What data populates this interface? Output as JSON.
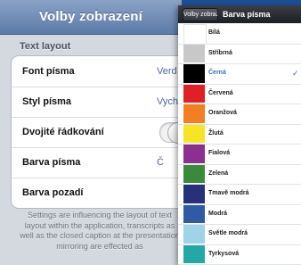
{
  "left": {
    "title": "Volby zobrazení",
    "section_header": "Text layout",
    "rows": [
      {
        "label": "Font písma",
        "value": "Verd"
      },
      {
        "label": "Styl písma",
        "value": "Vych"
      },
      {
        "label": "Dvojité řádkování",
        "toggle": false
      },
      {
        "label": "Barva písma",
        "value": "Č"
      },
      {
        "label": "Barva pozadí",
        "value": ""
      }
    ],
    "footer": "Settings are influencing the layout of text layout within the application, transcripts as well as the closed caption at the presentation mirroring are effected as"
  },
  "right": {
    "back_label": "Volby zobrazení",
    "title": "Barva písma",
    "selected_index": 2,
    "colors": [
      {
        "label": "Bílá",
        "color": "#ffffff"
      },
      {
        "label": "Stříbrná",
        "color": "#c8c8c8"
      },
      {
        "label": "Černá",
        "color": "#000000"
      },
      {
        "label": "Červená",
        "color": "#e01f26"
      },
      {
        "label": "Oranžová",
        "color": "#f47f22"
      },
      {
        "label": "Žlutá",
        "color": "#f5e524"
      },
      {
        "label": "Fialová",
        "color": "#8b2f91"
      },
      {
        "label": "Zelená",
        "color": "#3a8a3a"
      },
      {
        "label": "Tmavě modrá",
        "color": "#27307a"
      },
      {
        "label": "Modrá",
        "color": "#2e5aa6"
      },
      {
        "label": "Světle modrá",
        "color": "#9fd3e6"
      },
      {
        "label": "Tyrkysová",
        "color": "#23a8a6"
      }
    ]
  }
}
